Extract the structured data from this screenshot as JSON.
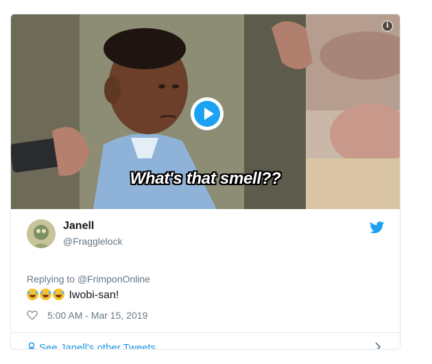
{
  "media": {
    "caption": "What's that smell??",
    "info_icon": "info-icon",
    "play_icon": "play-icon"
  },
  "tweet": {
    "author_name": "Janell",
    "author_handle": "@Fragglelock",
    "replying_prefix": "Replying to ",
    "replying_to": "@FrimponOnline",
    "text": "Iwobi-san!",
    "emoji": [
      "face-with-tears-of-joy",
      "face-with-tears-of-joy",
      "face-with-tears-of-joy"
    ],
    "timestamp": "5:00 AM - Mar 15, 2019",
    "like_icon": "heart-icon",
    "brand_icon": "twitter-bird-icon"
  },
  "footer": {
    "link_label": "See Janell's other Tweets",
    "chevron_icon": "chevron-right-icon"
  },
  "colors": {
    "accent": "#1da1f2",
    "link": "#1b95e0",
    "secondary_text": "#657786",
    "primary_text": "#14171a",
    "border": "#e1e8ed"
  }
}
